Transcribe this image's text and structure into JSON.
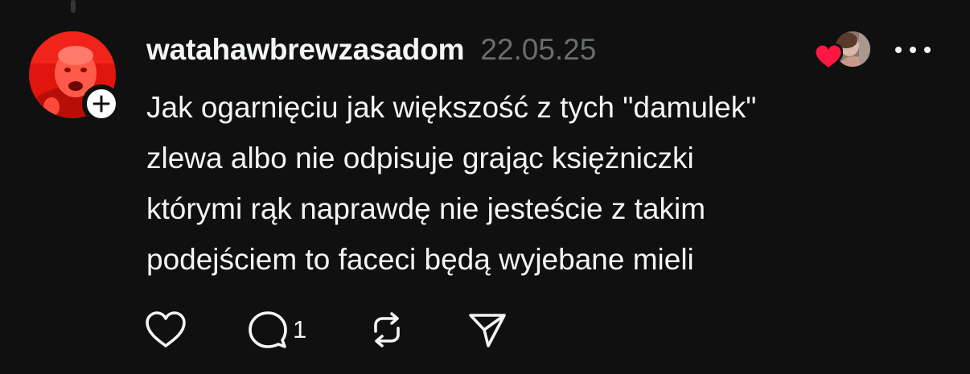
{
  "post": {
    "username": "watahawbrewzasadom",
    "timestamp": "22.05.25",
    "text": "Jak ogarnięciu jak większość z tych \"damulek\"\nzlewa albo nie odpisuje grając księżniczki\nktórymi rąk naprawdę nie jesteście z takim\npodejściem to faceci będą wyjebane mieli",
    "reply_count": "1"
  },
  "icons": {
    "avatar": "user-avatar-icon",
    "follow": "plus-icon",
    "liked_by": "heart-icon",
    "more": "more-dots-icon",
    "like": "heart-outline-icon",
    "reply": "comment-icon",
    "repost": "repost-icon",
    "share": "send-icon"
  },
  "colors": {
    "background": "#101010",
    "text": "#f3f5f7",
    "muted": "#6a6d70",
    "like_heart": "#ff1744",
    "avatar_red": "#e0150d"
  }
}
